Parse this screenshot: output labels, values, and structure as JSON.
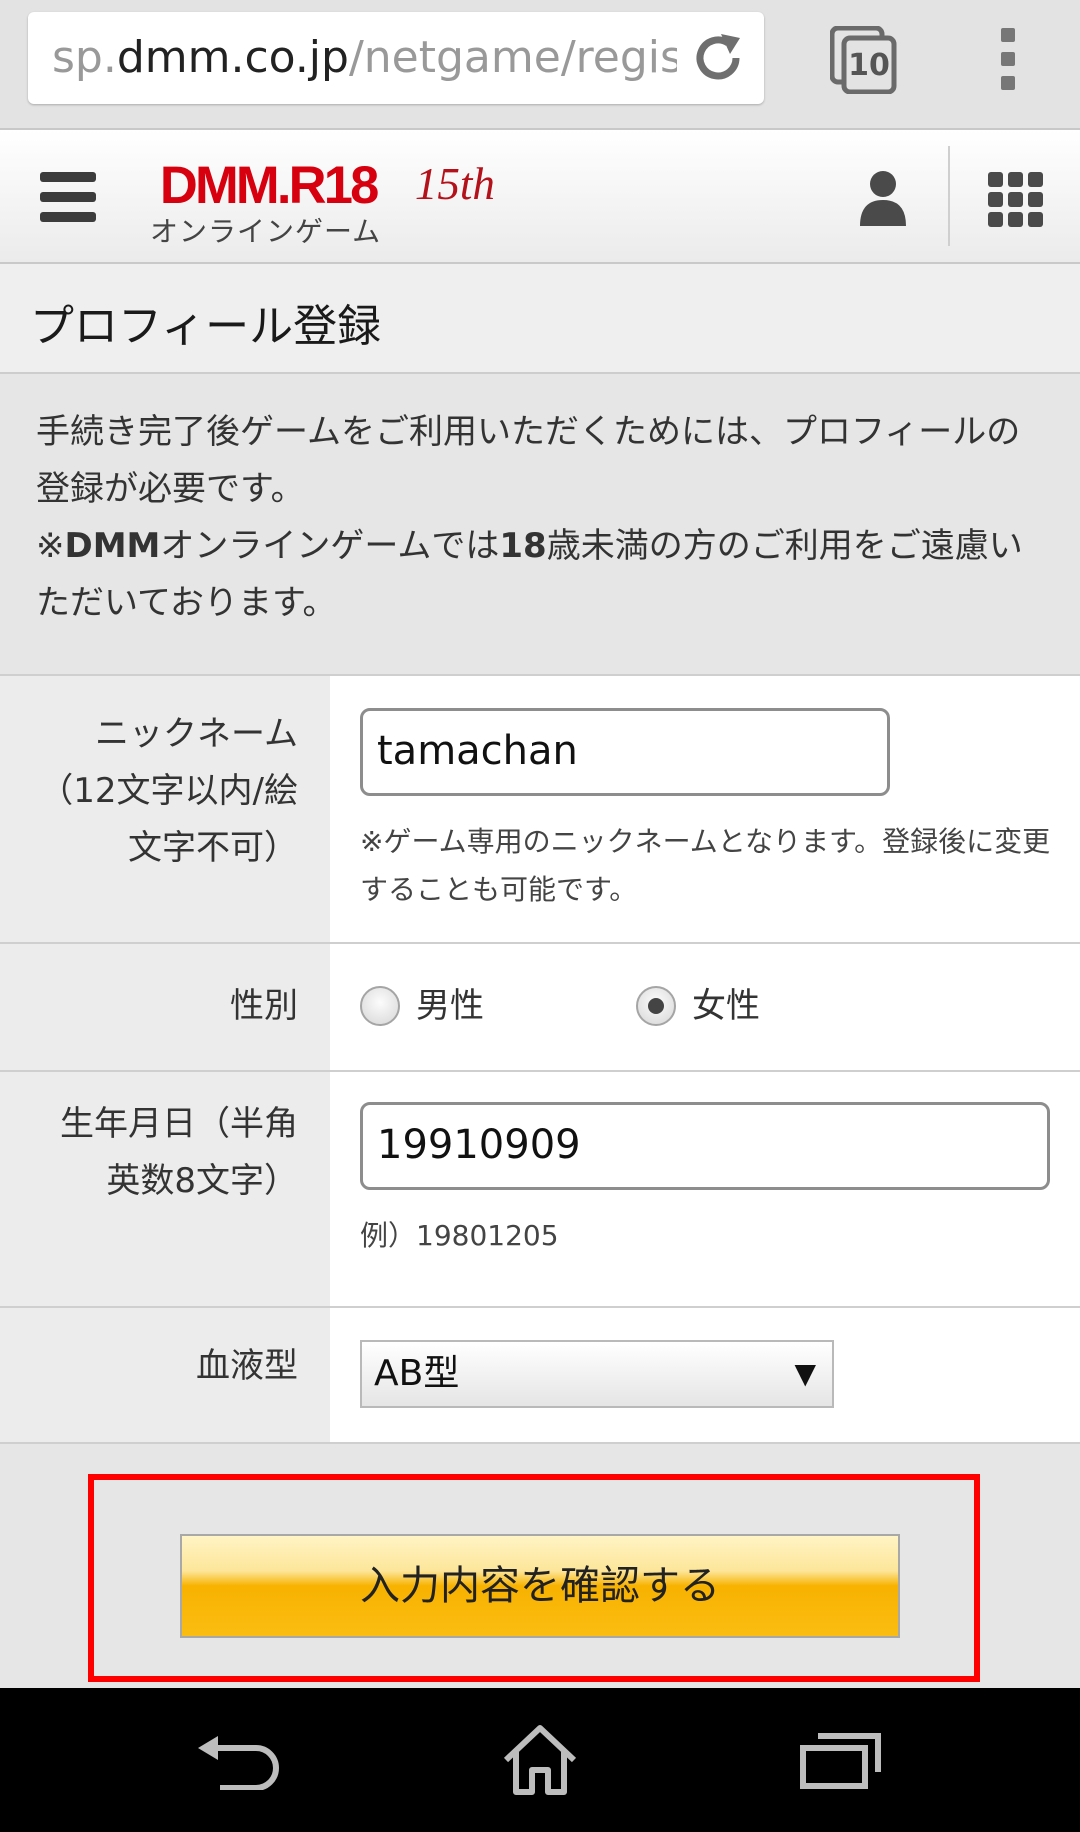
{
  "browser": {
    "url_prefix": "sp.",
    "url_domain": "dmm.co.jp",
    "url_path": "/netgame/regist/",
    "tab_count": "10"
  },
  "header": {
    "logo_text": "DMM.R18",
    "logo_badge": "15th",
    "logo_subtitle": "オンラインゲーム"
  },
  "page": {
    "title": "プロフィール登録",
    "notice": {
      "line1": "手続き完了後ゲームをご利用いただくためには、プロフィールの登録が必要です。",
      "line2_prefix": "※",
      "line2_brand": "DMM",
      "line2_mid": "オンラインゲームでは",
      "line2_age": "18",
      "line2_rest": "歳未満の方のご利用をご遠慮いただいております。"
    }
  },
  "form": {
    "nickname": {
      "label": "ニックネーム（12文字以内/絵文字不可）",
      "value": "tamachan",
      "hint": "※ゲーム専用のニックネームとなります。登録後に変更することも可能です。"
    },
    "gender": {
      "label": "性別",
      "options": [
        "男性",
        "女性"
      ],
      "selected": "女性"
    },
    "birthday": {
      "label": "生年月日（半角英数8文字）",
      "value": "19910909",
      "hint": "例）19801205"
    },
    "blood_type": {
      "label": "血液型",
      "value": "AB型"
    }
  },
  "actions": {
    "confirm_label": "入力内容を確認する"
  },
  "colors": {
    "logo_red": "#d7000f",
    "highlight_red": "#ff0000",
    "button_gold": "#f8b200"
  },
  "icons": [
    "reload-icon",
    "tabs-icon",
    "overflow-menu-icon",
    "hamburger-menu-icon",
    "user-icon",
    "app-grid-icon",
    "back-icon",
    "home-icon",
    "recent-apps-icon"
  ]
}
